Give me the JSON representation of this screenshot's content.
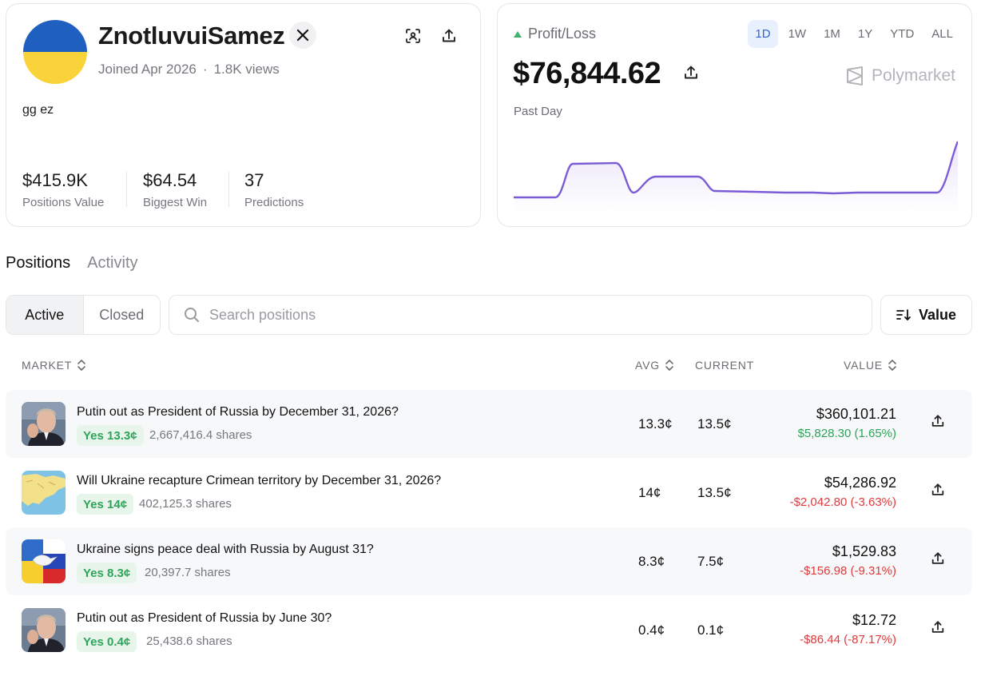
{
  "profile": {
    "username": "ZnotluvuiSamez",
    "joined": "Joined Apr 2026",
    "views": "1.8K views",
    "bio": "gg ez",
    "flag_colors": [
      "#1f5fbf",
      "#f8d33a"
    ],
    "stats": [
      {
        "value": "$415.9K",
        "label": "Positions Value"
      },
      {
        "value": "$64.54",
        "label": "Biggest Win"
      },
      {
        "value": "37",
        "label": "Predictions"
      }
    ]
  },
  "pnl": {
    "label": "Profit/Loss",
    "value": "$76,844.62",
    "period": "Past Day",
    "brand": "Polymarket",
    "ranges": [
      "1D",
      "1W",
      "1M",
      "1Y",
      "YTD",
      "ALL"
    ],
    "active_range": "1D",
    "trend_color": "#3fb16a",
    "line_color": "#7b5cd6"
  },
  "tabs": [
    "Positions",
    "Activity"
  ],
  "filters": {
    "segments": [
      "Active",
      "Closed"
    ],
    "search_placeholder": "Search positions",
    "sort_label": "Value"
  },
  "table": {
    "headers": {
      "market": "MARKET",
      "avg": "AVG",
      "current": "CURRENT",
      "value": "VALUE"
    },
    "rows": [
      {
        "title": "Putin out as President of Russia by December 31, 2026?",
        "outcome": "Yes 13.3¢",
        "shares": "2,667,416.4 shares",
        "avg": "13.3¢",
        "current": "13.5¢",
        "value": "$360,101.21",
        "change": "$5,828.30 (1.65%)",
        "change_dir": "pos",
        "thumb": "portrait-icon"
      },
      {
        "title": "Will Ukraine recapture Crimean territory by December 31, 2026?",
        "outcome": "Yes 14¢",
        "shares": "402,125.3 shares",
        "avg": "14¢",
        "current": "13.5¢",
        "value": "$54,286.92",
        "change": "-$2,042.80 (-3.63%)",
        "change_dir": "neg",
        "thumb": "map-icon"
      },
      {
        "title": "Ukraine signs peace deal with Russia by August 31?",
        "outcome": "Yes 8.3¢",
        "shares": "20,397.7 shares",
        "avg": "8.3¢",
        "current": "7.5¢",
        "value": "$1,529.83",
        "change": "-$156.98 (-9.31%)",
        "change_dir": "neg",
        "thumb": "flags-dove-icon"
      },
      {
        "title": "Putin out as President of Russia by June 30?",
        "outcome": "Yes 0.4¢",
        "shares": "25,438.6 shares",
        "avg": "0.4¢",
        "current": "0.1¢",
        "value": "$12.72",
        "change": "-$86.44 (-87.17%)",
        "change_dir": "neg",
        "thumb": "portrait-icon"
      }
    ]
  }
}
